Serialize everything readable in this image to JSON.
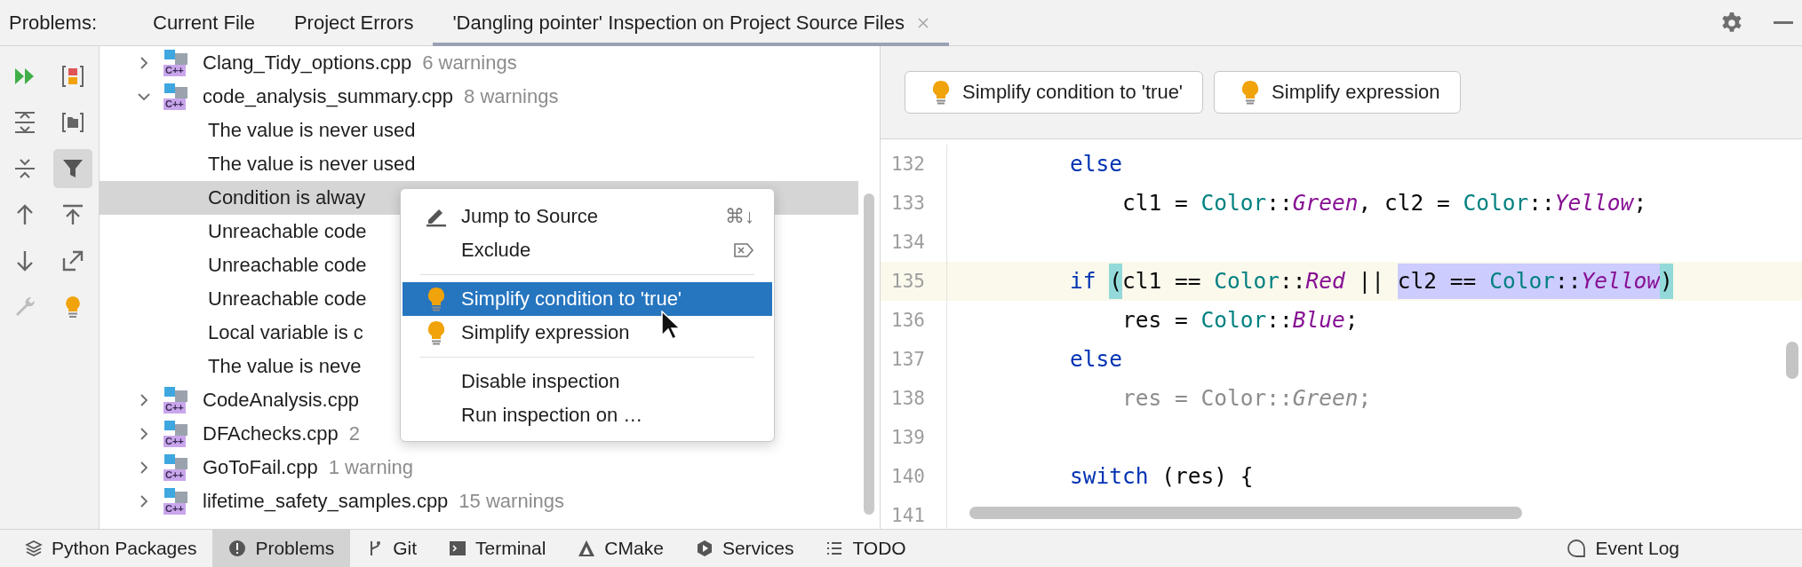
{
  "tool_window": {
    "label": "Problems:"
  },
  "tabs": [
    {
      "label": "Current File",
      "selected": false,
      "closable": false
    },
    {
      "label": "Project Errors",
      "selected": false,
      "closable": false
    },
    {
      "label": "'Dangling pointer' Inspection on Project Source Files",
      "selected": true,
      "closable": true
    }
  ],
  "toolbar": [
    {
      "kind": "run",
      "on": false,
      "disabled": false
    },
    {
      "kind": "severity",
      "on": false,
      "disabled": false
    },
    {
      "kind": "expand",
      "on": false,
      "disabled": false
    },
    {
      "kind": "module",
      "on": false,
      "disabled": false
    },
    {
      "kind": "collapse",
      "on": false,
      "disabled": false
    },
    {
      "kind": "filter",
      "on": true,
      "disabled": false
    },
    {
      "kind": "up",
      "on": false,
      "disabled": false
    },
    {
      "kind": "export",
      "on": false,
      "disabled": false
    },
    {
      "kind": "down",
      "on": false,
      "disabled": false
    },
    {
      "kind": "open",
      "on": false,
      "disabled": false
    },
    {
      "kind": "wrench",
      "on": false,
      "disabled": true
    },
    {
      "kind": "bulb",
      "on": false,
      "disabled": false
    }
  ],
  "tree": [
    {
      "name": "Clang_Tidy_options.cpp",
      "badge": "C++",
      "count": "6 warnings",
      "expanded": false,
      "selected": false
    },
    {
      "name": "code_analysis_summary.cpp",
      "badge": "C++",
      "count": "8 warnings",
      "expanded": true,
      "selected": false,
      "children": [
        {
          "text": "The value is never used",
          "selected": false
        },
        {
          "text": "The value is never used",
          "selected": false
        },
        {
          "text": "Condition is alway",
          "selected": true
        },
        {
          "text": "Unreachable code",
          "selected": false
        },
        {
          "text": "Unreachable code",
          "selected": false
        },
        {
          "text": "Unreachable code",
          "selected": false
        },
        {
          "text": "Local variable is c",
          "selected": false
        },
        {
          "text": "The value is neve",
          "selected": false
        }
      ]
    },
    {
      "name": "CodeAnalysis.cpp",
      "badge": "C++",
      "expanded": false,
      "selected": false
    },
    {
      "name": "DFAchecks.cpp",
      "badge": "C++",
      "count": "2",
      "expanded": false,
      "selected": false
    },
    {
      "name": "GoToFail.cpp",
      "badge": "C++",
      "count": "1 warning",
      "expanded": false,
      "selected": false
    },
    {
      "name": "lifetime_safety_samples.cpp",
      "badge": "C++",
      "count": "15 warnings",
      "expanded": false,
      "selected": false
    }
  ],
  "context_menu": [
    {
      "kind": "edit",
      "label": "Jump to Source",
      "shortcut": "⌘↓",
      "selected": false
    },
    {
      "kind": "exclude",
      "label": "Exclude",
      "selected": false
    },
    {
      "kind": "separator"
    },
    {
      "kind": "fix",
      "label": "Simplify condition to 'true'",
      "selected": true
    },
    {
      "kind": "fix",
      "label": "Simplify expression",
      "selected": false
    },
    {
      "kind": "separator"
    },
    {
      "kind": "plain",
      "label": "Disable inspection",
      "selected": false
    },
    {
      "kind": "plain",
      "label": "Run inspection on …",
      "selected": false
    }
  ],
  "quick_fixes": [
    {
      "label": "Simplify condition to 'true'"
    },
    {
      "label": "Simplify expression"
    }
  ],
  "editor": {
    "lines": [
      {
        "number": "132",
        "current": false,
        "tokens": [
          {
            "text": "        else",
            "kind": "keyword"
          }
        ]
      },
      {
        "number": "133",
        "current": false,
        "tokens": [
          {
            "text": "            cl1 = ",
            "kind": "plain"
          },
          {
            "text": "Color",
            "kind": "class"
          },
          {
            "text": "::",
            "kind": "plain"
          },
          {
            "text": "Green",
            "kind": "member"
          },
          {
            "text": ", cl2 = ",
            "kind": "plain"
          },
          {
            "text": "Color",
            "kind": "class"
          },
          {
            "text": "::",
            "kind": "plain"
          },
          {
            "text": "Yellow",
            "kind": "member"
          },
          {
            "text": ";",
            "kind": "plain"
          }
        ]
      },
      {
        "number": "134",
        "current": false
      },
      {
        "number": "135",
        "current": true,
        "tokens": [
          {
            "text": "        if ",
            "kind": "keyword",
            "brace_match": false,
            "selected": false
          },
          {
            "text": "(",
            "kind": "plain",
            "brace_match": true,
            "selected": false
          },
          {
            "text": "cl1 == ",
            "kind": "plain",
            "brace_match": false,
            "selected": false
          },
          {
            "text": "Color",
            "kind": "class",
            "brace_match": false,
            "selected": false
          },
          {
            "text": "::",
            "kind": "plain",
            "brace_match": false,
            "selected": false
          },
          {
            "text": "Red",
            "kind": "member",
            "brace_match": false,
            "selected": false
          },
          {
            "text": " || ",
            "kind": "plain",
            "brace_match": false,
            "selected": false
          },
          {
            "text": "cl2 == ",
            "kind": "plain",
            "brace_match": false,
            "selected": true
          },
          {
            "text": "Color",
            "kind": "class",
            "brace_match": false,
            "selected": true
          },
          {
            "text": "::",
            "kind": "plain",
            "brace_match": false,
            "selected": true
          },
          {
            "text": "Yellow",
            "kind": "member",
            "brace_match": false,
            "selected": true
          },
          {
            "text": ")",
            "kind": "plain",
            "brace_match": true,
            "selected": false
          }
        ]
      },
      {
        "number": "136",
        "current": false,
        "tokens": [
          {
            "text": "            res = ",
            "kind": "plain"
          },
          {
            "text": "Color",
            "kind": "class"
          },
          {
            "text": "::",
            "kind": "plain"
          },
          {
            "text": "Blue",
            "kind": "member"
          },
          {
            "text": ";",
            "kind": "plain"
          }
        ]
      },
      {
        "number": "137",
        "current": false,
        "tokens": [
          {
            "text": "        else",
            "kind": "keyword"
          }
        ]
      },
      {
        "number": "138",
        "current": false,
        "tokens": [
          {
            "text": "            res = Color::",
            "kind": "unused"
          },
          {
            "text": "Green",
            "kind": "unused_member"
          },
          {
            "text": ";",
            "kind": "unused"
          }
        ]
      },
      {
        "number": "139",
        "current": false
      },
      {
        "number": "140",
        "current": false,
        "tokens": [
          {
            "text": "        switch",
            "kind": "keyword"
          },
          {
            "text": " (res) {",
            "kind": "plain"
          }
        ]
      },
      {
        "number": "141",
        "current": false
      }
    ]
  },
  "bottom_bar": {
    "items": [
      {
        "kind": "packages",
        "label": "Python Packages",
        "selected": false
      },
      {
        "kind": "problems",
        "label": "Problems",
        "selected": true
      },
      {
        "kind": "git",
        "label": "Git",
        "selected": false
      },
      {
        "kind": "terminal",
        "label": "Terminal",
        "selected": false
      },
      {
        "kind": "cmake",
        "label": "CMake",
        "selected": false
      },
      {
        "kind": "services",
        "label": "Services",
        "selected": false
      },
      {
        "kind": "todo",
        "label": "TODO",
        "selected": false
      }
    ],
    "right_items": [
      {
        "kind": "events",
        "label": "Event Log",
        "selected": false
      }
    ]
  }
}
